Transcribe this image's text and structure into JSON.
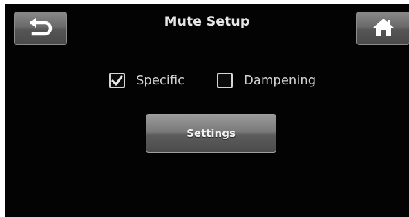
{
  "header": {
    "title": "Mute Setup",
    "back_icon": "back-arrow-icon",
    "home_icon": "home-icon"
  },
  "options": {
    "specific": {
      "label": "Specific",
      "checked": true
    },
    "dampening": {
      "label": "Dampening",
      "checked": false
    }
  },
  "actions": {
    "settings_label": "Settings"
  },
  "colors": {
    "background": "#030303",
    "text": "#d2d2d2",
    "button_top": "#9a9a9a",
    "button_bottom": "#4b4b4b"
  }
}
